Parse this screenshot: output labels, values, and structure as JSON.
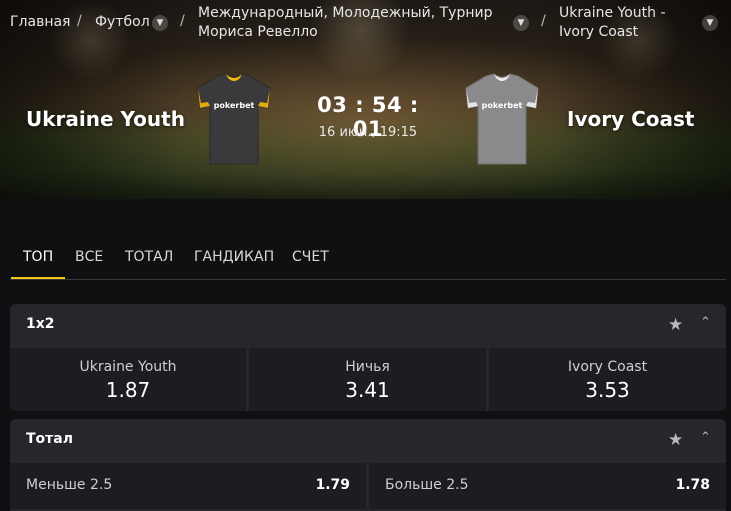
{
  "breadcrumb": {
    "home": "Главная",
    "sport": "Футбол",
    "tournament_line1": "Международный, Молодежный, Турнир",
    "tournament_line2": "Мориса Ревелло",
    "match_line1": "Ukraine Youth -",
    "match_line2": "Ivory Coast",
    "separator": "/"
  },
  "match": {
    "home_team": "Ukraine Youth",
    "away_team": "Ivory Coast",
    "countdown": "03 : 54 : 01",
    "datetime": "16 июн., 19:15",
    "jersey_brand": "pokerbet"
  },
  "tabs": [
    "ТОП",
    "ВСЕ",
    "ТОТАЛ",
    "ГАНДИКАП",
    "СЧЕТ"
  ],
  "markets": {
    "m1x2": {
      "title": "1x2",
      "outcomes": [
        {
          "label": "Ukraine Youth",
          "odd": "1.87"
        },
        {
          "label": "Ничья",
          "odd": "3.41"
        },
        {
          "label": "Ivory Coast",
          "odd": "3.53"
        }
      ]
    },
    "total": {
      "title": "Тотал",
      "outcomes": [
        {
          "label": "Меньше 2.5",
          "odd": "1.79"
        },
        {
          "label": "Больше 2.5",
          "odd": "1.78"
        }
      ]
    }
  },
  "icons": {
    "chevron": "chevron-down-icon",
    "star": "star-icon",
    "collapse": "chevron-up-icon"
  },
  "colors": {
    "accent": "#f5c518",
    "home_jersey": "#3a3a3c",
    "home_trim": "#f2b705",
    "away_jersey": "#8a8a8c",
    "away_trim": "#eeeeee",
    "card_bg": "#26272b",
    "odd_bg": "#1c1d21",
    "page_bg": "#101012"
  }
}
